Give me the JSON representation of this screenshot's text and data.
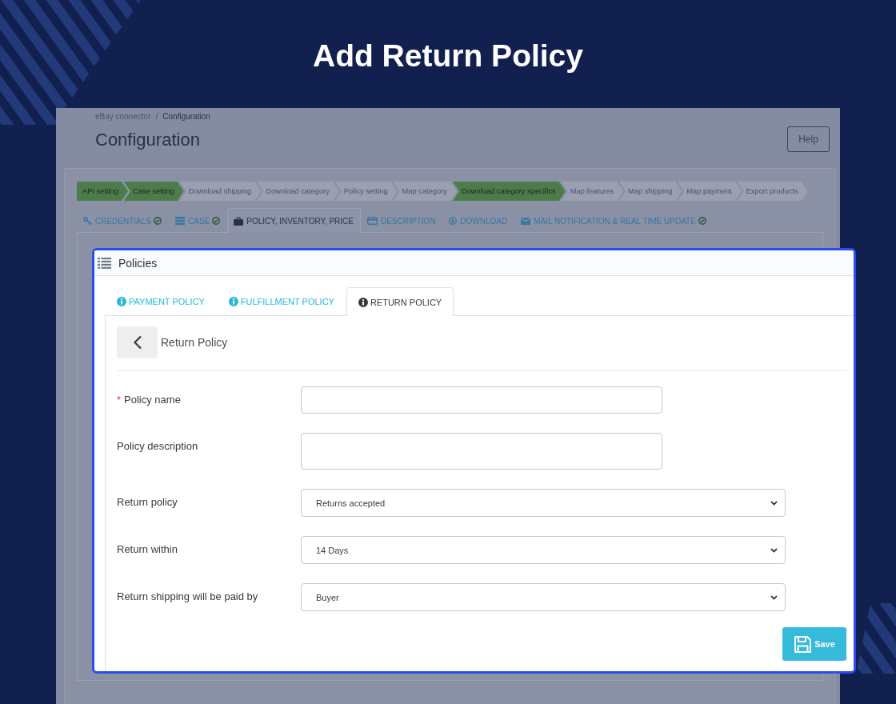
{
  "headline": "Add Return Policy",
  "background_page": {
    "breadcrumb": {
      "items": [
        "eBay connector",
        "Configuration"
      ],
      "separator": "/"
    },
    "title": "Configuration",
    "help_button": "Help",
    "steps": [
      {
        "label": "API setting",
        "done": true
      },
      {
        "label": "Case setting",
        "done": true
      },
      {
        "label": "Download shipping",
        "done": false
      },
      {
        "label": "Download category",
        "done": false
      },
      {
        "label": "Policy setting",
        "done": false
      },
      {
        "label": "Map category",
        "done": false
      },
      {
        "label": "Download category specifics",
        "done": true
      },
      {
        "label": "Map features",
        "done": false
      },
      {
        "label": "Map shipping",
        "done": false
      },
      {
        "label": "Map payment",
        "done": false
      },
      {
        "label": "Export products",
        "done": false
      }
    ],
    "tabs": [
      {
        "label": "CREDENTIALS",
        "selected": false,
        "verified": true
      },
      {
        "label": "CASE",
        "selected": false,
        "verified": true
      },
      {
        "label": "POLICY, INVENTORY, PRICE",
        "selected": true,
        "verified": false
      },
      {
        "label": "DESCRIPTION",
        "selected": false,
        "verified": false
      },
      {
        "label": "DOWNLOAD",
        "selected": false,
        "verified": false
      },
      {
        "label": "MAIL NOTIFICATION & REAL TIME UPDATE",
        "selected": false,
        "verified": true
      }
    ]
  },
  "policies_panel": {
    "title": "Policies",
    "tabs": [
      {
        "label": "PAYMENT POLICY",
        "selected": false
      },
      {
        "label": "FULFILLMENT POLICY",
        "selected": false
      },
      {
        "label": "RETURN POLICY",
        "selected": true
      }
    ],
    "section_title": "Return Policy",
    "required_mark": "*",
    "fields": [
      {
        "kind": "text",
        "label": "Policy name",
        "required": true
      },
      {
        "kind": "textarea",
        "label": "Policy description",
        "required": false
      },
      {
        "kind": "select",
        "label": "Return policy",
        "required": false,
        "value": "Returns accepted"
      },
      {
        "kind": "select",
        "label": "Return within",
        "required": false,
        "value": "14 Days"
      },
      {
        "kind": "select",
        "label": "Return shipping will be paid by",
        "required": false,
        "value": "Buyer"
      }
    ],
    "save_button": "Save"
  }
}
